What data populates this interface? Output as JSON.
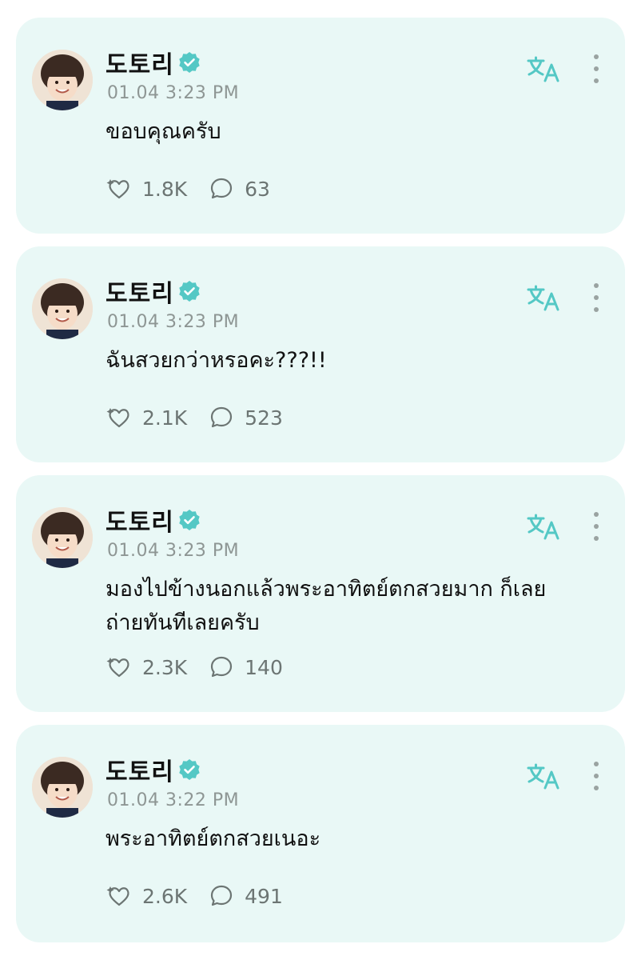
{
  "colors": {
    "card_bg": "#e9f8f6",
    "accent": "#54c8c5",
    "muted": "#8e9694"
  },
  "icons": {
    "translate": "translate-icon",
    "more": "more-vertical-icon",
    "like": "heart-sparkle-icon",
    "comment": "comment-bubble-icon",
    "verified": "verified-badge-icon"
  },
  "posts": [
    {
      "name": "도토리",
      "time": "01.04 3:23 PM",
      "text": "ขอบคุณครับ",
      "likes": "1.8K",
      "comments": "63"
    },
    {
      "name": "도토리",
      "time": "01.04 3:23 PM",
      "text": "ฉันสวยกว่าหรอคะ???!!",
      "likes": "2.1K",
      "comments": "523"
    },
    {
      "name": "도토리",
      "time": "01.04 3:23 PM",
      "text_line1": "มองไปข้างนอกแล้วพระอาทิตย์ตกสวยมาก ก็เลย",
      "text_line2": "ถ่ายทันทีเลยครับ",
      "likes": "2.3K",
      "comments": "140"
    },
    {
      "name": "도토리",
      "time": "01.04 3:22 PM",
      "text": "พระอาทิตย์ตกสวยเนอะ",
      "likes": "2.6K",
      "comments": "491"
    }
  ]
}
